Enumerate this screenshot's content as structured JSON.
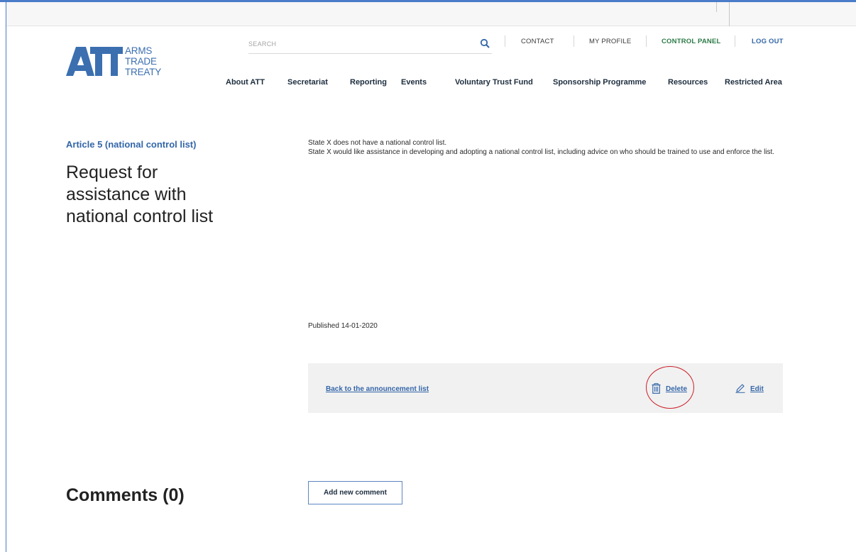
{
  "logo": {
    "mark": "ATT",
    "words": [
      "ARMS",
      "TRADE",
      "TREATY"
    ]
  },
  "search": {
    "placeholder": "SEARCH",
    "icon": "search-icon"
  },
  "utility": {
    "contact": "CONTACT",
    "my_profile": "MY PROFILE",
    "control_panel": "CONTROL PANEL",
    "log_out": "LOG OUT"
  },
  "nav": {
    "items": [
      "About ATT",
      "Secretariat",
      "Reporting",
      "Events",
      "Voluntary Trust Fund",
      "Sponsorship Programme",
      "Resources",
      "Restricted Area"
    ]
  },
  "article": {
    "category": "Article 5 (national control list)",
    "title": "Request for assistance with national control list",
    "body": [
      "State X does not have a national control list.",
      "State X would like assistance in developing and adopting a national control list, including advice on who should be trained to use and enforce the list."
    ],
    "published": "Published 14-01-2020"
  },
  "actions": {
    "back": "Back to the announcement list",
    "delete": "Delete",
    "edit": "Edit"
  },
  "comments": {
    "title": "Comments (0)",
    "add_button": "Add new comment"
  },
  "colors": {
    "brand_blue": "#3466a8",
    "control_panel_green": "#2c7a47",
    "highlight_red": "#cc1f2a",
    "action_bar_bg": "#f1f1f1"
  }
}
